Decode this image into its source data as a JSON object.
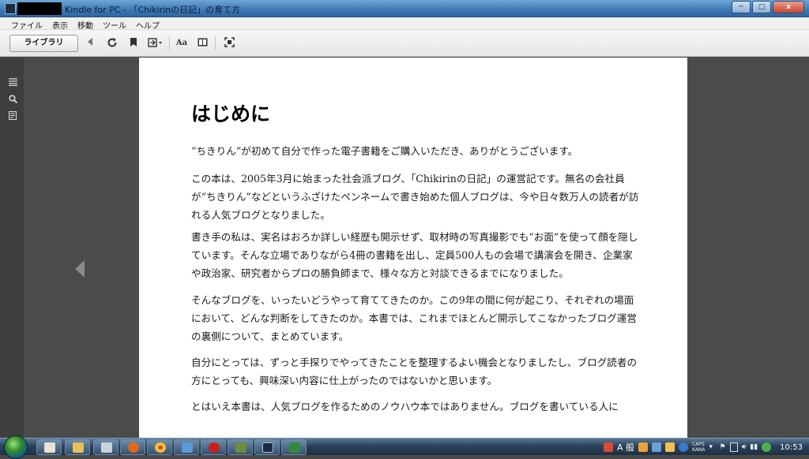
{
  "window": {
    "title": "Kindle for PC - 「Chikirinの日記」の育て方",
    "minimize_label": "─",
    "maximize_label": "□",
    "close_label": "x"
  },
  "menu": {
    "items": [
      {
        "label": "ファイル"
      },
      {
        "label": "表示"
      },
      {
        "label": "移動"
      },
      {
        "label": "ツール"
      },
      {
        "label": "ヘルプ"
      }
    ]
  },
  "toolbar": {
    "library_label": "ライブラリ",
    "icons": [
      "back-icon",
      "sync-icon",
      "bookmark-icon",
      "goto-icon",
      "font-size-icon",
      "view-mode-icon",
      "fullscreen-icon"
    ],
    "font_label": "Aa"
  },
  "left_rail": {
    "icons": [
      "contents-icon",
      "search-icon",
      "notes-icon"
    ]
  },
  "book": {
    "chapter_title": "はじめに",
    "paragraphs": [
      "“ちきりん”が初めて自分で作った電子書籍をご購入いただき、ありがとうございます。",
      "この本は、2005年3月に始まった社会派ブログ、「Chikirinの日記」の運営記です。無名の会社員が“ちきりん”などというふざけたペンネームで書き始めた個人ブログは、今や日々数万人の読者が訪れる人気ブログとなりました。",
      "書き手の私は、実名はおろか詳しい経歴も開示せず、取材時の写真撮影でも“お面”を使って顔を隠しています。そんな立場でありながら4冊の書籍を出し、定員500人もの会場で講演会を開き、企業家や政治家、研究者からプロの勝負師まで、様々な方と対談できるまでになりました。",
      "そんなブログを、いったいどうやって育ててきたのか。この9年の間に何が起こり、それぞれの場面において、どんな判断をしてきたのか。本書では、これまでほとんど開示してこなかったブログ運営の裏側について、まとめています。",
      "自分にとっては、ずっと手探りでやってきたことを整理するよい機会となりましたし、ブログ読者の方にとっても、興味深い内容に仕上がったのではないかと思います。",
      "とはいえ本書は、人気ブログを作るためのノウハウ本ではありません。ブログを書いている人に"
    ]
  },
  "taskbar": {
    "apps": [
      "explorer",
      "folder",
      "document",
      "firefox",
      "chrome",
      "network",
      "pdf",
      "kindle-app",
      "excel"
    ],
    "ime_label": "A 般",
    "caps_label": "CAPS",
    "kana_label": "KANA",
    "clock": "10:53"
  },
  "colors": {
    "title_bar": "#3d78b5",
    "reader_background": "#4b4b4b",
    "page_background": "#ffffff"
  }
}
